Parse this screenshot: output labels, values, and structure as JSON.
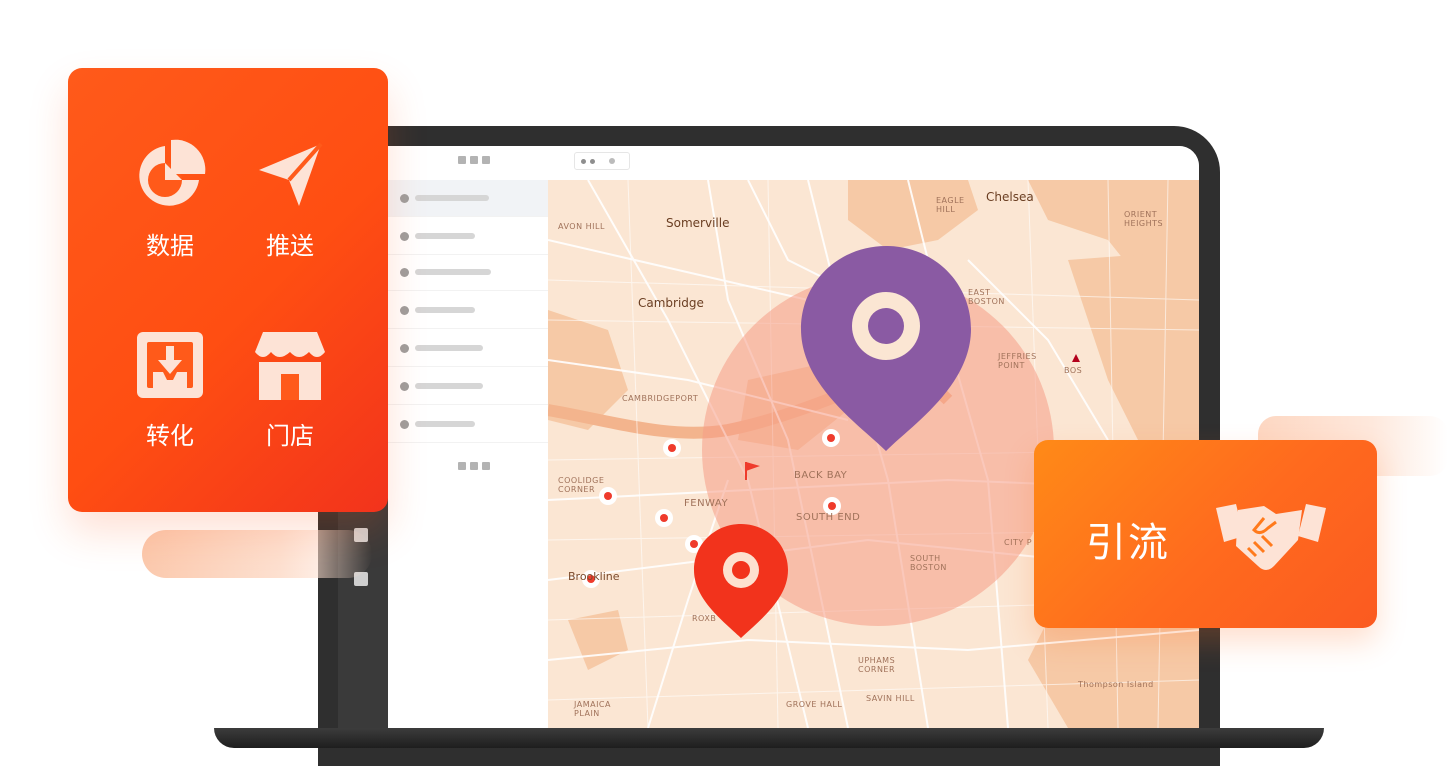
{
  "feature_card": {
    "items": [
      {
        "label": "数据",
        "icon": "pie-chart-icon"
      },
      {
        "label": "推送",
        "icon": "paper-plane-icon"
      },
      {
        "label": "转化",
        "icon": "inbox-download-icon"
      },
      {
        "label": "门店",
        "icon": "storefront-icon"
      }
    ]
  },
  "traffic_card": {
    "label": "引流",
    "icon": "handshake-icon"
  },
  "map": {
    "labels": {
      "somerville": "Somerville",
      "chelsea": "Chelsea",
      "cambridge": "Cambridge",
      "back_bay": "BACK BAY",
      "fenway": "FENWAY",
      "south_end": "SOUTH END",
      "south_boston": "SOUTH BOSTON",
      "brookline": "Brookline",
      "east_boston": "EAST BOSTON",
      "jeffries_point": "JEFFRIES POINT",
      "bos": "BOS",
      "city_point": "CITY P",
      "avon_hill": "AVON HILL",
      "orient_heights": "ORIENT HEIGHTS",
      "uphams_corner": "UPHAMS CORNER",
      "savin_hill": "SAVIN HILL",
      "grove_hall": "GROVE HALL",
      "jamaica_plain": "JAMAICA PLAIN",
      "cambridgeport": "CAMBRIDGEPORT",
      "coolidge_corner": "COOLIDGE CORNER",
      "roxbury": "ROXB",
      "eagle_hill": "EAGLE HILL",
      "thompson_island": "Thompson Island"
    }
  },
  "colors": {
    "brand_orange": "#ff5a1a",
    "traffic_orange": "#ff8a17",
    "pin_purple": "#8a5aa3",
    "pin_red": "#f2331c",
    "map_bg": "#fbe6d3",
    "map_water": "#f5c29e"
  }
}
